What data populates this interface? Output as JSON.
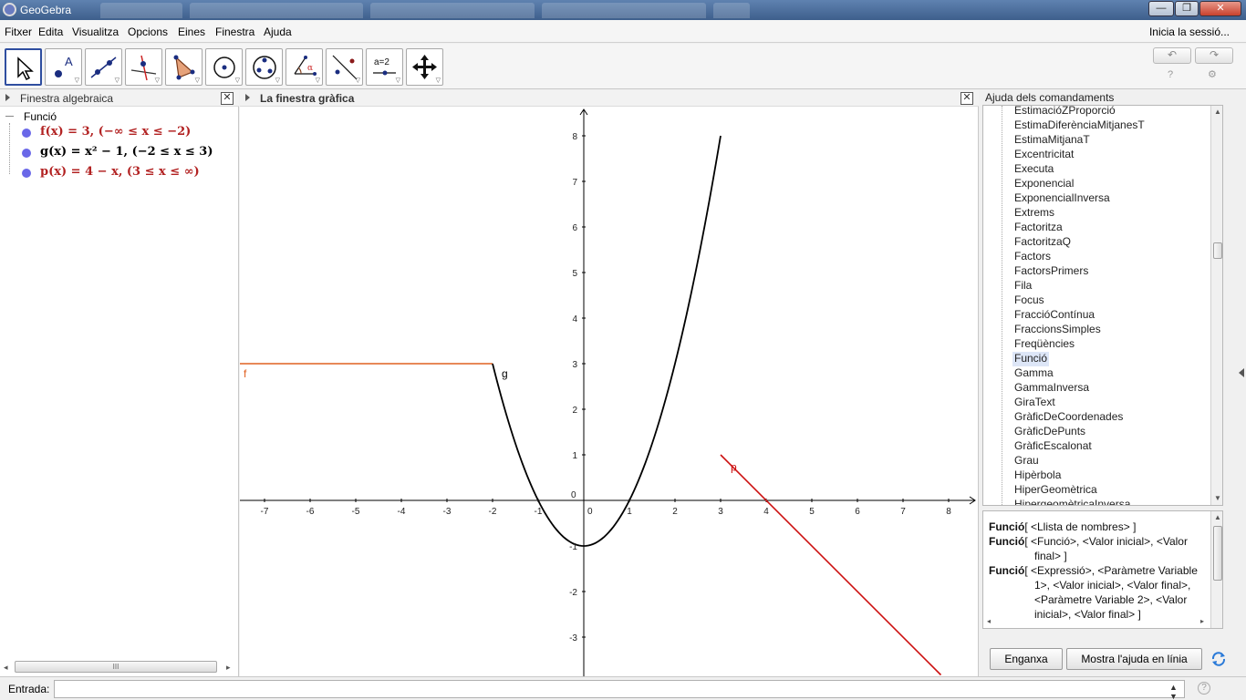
{
  "window": {
    "title": "GeoGebra",
    "controls": {
      "minimize": "—",
      "maximize": "❐",
      "close": "✕"
    }
  },
  "menubar": {
    "items": [
      "Fitxer",
      "Edita",
      "Visualitza",
      "Opcions",
      "Eines",
      "Finestra",
      "Ajuda"
    ],
    "signin": "Inicia la sessió..."
  },
  "toolbar": {
    "tools": [
      {
        "name": "move-tool-icon",
        "selected": true
      },
      {
        "name": "point-tool-icon"
      },
      {
        "name": "line-tool-icon"
      },
      {
        "name": "perpendicular-line-tool-icon"
      },
      {
        "name": "polygon-tool-icon"
      },
      {
        "name": "circle-tool-icon"
      },
      {
        "name": "conic-tool-icon"
      },
      {
        "name": "angle-tool-icon"
      },
      {
        "name": "reflect-tool-icon"
      },
      {
        "name": "slider-tool-icon",
        "label": "a=2"
      },
      {
        "name": "move-graphics-view-tool-icon"
      }
    ],
    "undo": "↶",
    "redo": "↷",
    "help": "?",
    "settings": "⚙"
  },
  "algebra": {
    "title": "Finestra algebraica",
    "group": "Funció",
    "functions": [
      {
        "text": "f(x) = 3,    (−∞ ≤ x ≤ −2)",
        "color": "#b22222"
      },
      {
        "text": "g(x) = x² − 1,    (−2 ≤ x ≤ 3)",
        "color": "#000000"
      },
      {
        "text": "p(x) = 4 − x,    (3 ≤ x ≤ ∞)",
        "color": "#b22222"
      }
    ],
    "dot_color": "#6a68e8",
    "scroll_grip": "III"
  },
  "graphics": {
    "title": "La finestra gràfica",
    "x_ticks": [
      "-7",
      "-6",
      "-5",
      "-4",
      "-3",
      "-2",
      "-1",
      "0",
      "1",
      "2",
      "3",
      "4",
      "5",
      "6",
      "7",
      "8"
    ],
    "y_ticks": [
      "8",
      "7",
      "6",
      "5",
      "4",
      "3",
      "2",
      "1",
      "0",
      "-1",
      "-2",
      "-3"
    ],
    "labels": {
      "f": "f",
      "g": "g",
      "p": "p"
    },
    "colors": {
      "f": "#e06020",
      "g": "#000000",
      "p": "#cc1010"
    }
  },
  "help": {
    "title": "Ajuda dels comandaments",
    "commands": [
      "EstimacióZProporció",
      "EstimaDiferènciaMitjanesT",
      "EstimaMitjanaT",
      "Excentricitat",
      "Executa",
      "Exponencial",
      "ExponencialInversa",
      "Extrems",
      "Factoritza",
      "FactoritzaQ",
      "Factors",
      "FactorsPrimers",
      "Fila",
      "Focus",
      "FraccióContínua",
      "FraccionsSimples",
      "Freqüències",
      "Funció",
      "Gamma",
      "GammaInversa",
      "GiraText",
      "GràficDeCoordenades",
      "GràficDePunts",
      "GràficEscalonat",
      "Grau",
      "Hipèrbola",
      "HiperGeomètrica",
      "HipergeomètricaInversa"
    ],
    "selected": "Funció",
    "syntax": [
      {
        "cmd": "Funció",
        "args": "[ <Llista de nombres> ]"
      },
      {
        "cmd": "Funció",
        "args": "[ <Funció>, <Valor inicial>, <Valor",
        "cont": [
          "final> ]"
        ]
      },
      {
        "cmd": "Funció",
        "args": "[ <Expressió>, <Paràmetre Variable",
        "cont": [
          "1>, <Valor inicial>, <Valor final>,",
          "<Paràmetre Variable 2>, <Valor",
          "inicial>, <Valor final> ]"
        ]
      }
    ],
    "paste_button": "Enganxa",
    "online_help_button": "Mostra l'ajuda en línia"
  },
  "input": {
    "label": "Entrada:",
    "value": "",
    "placeholder": "",
    "help": "?"
  }
}
